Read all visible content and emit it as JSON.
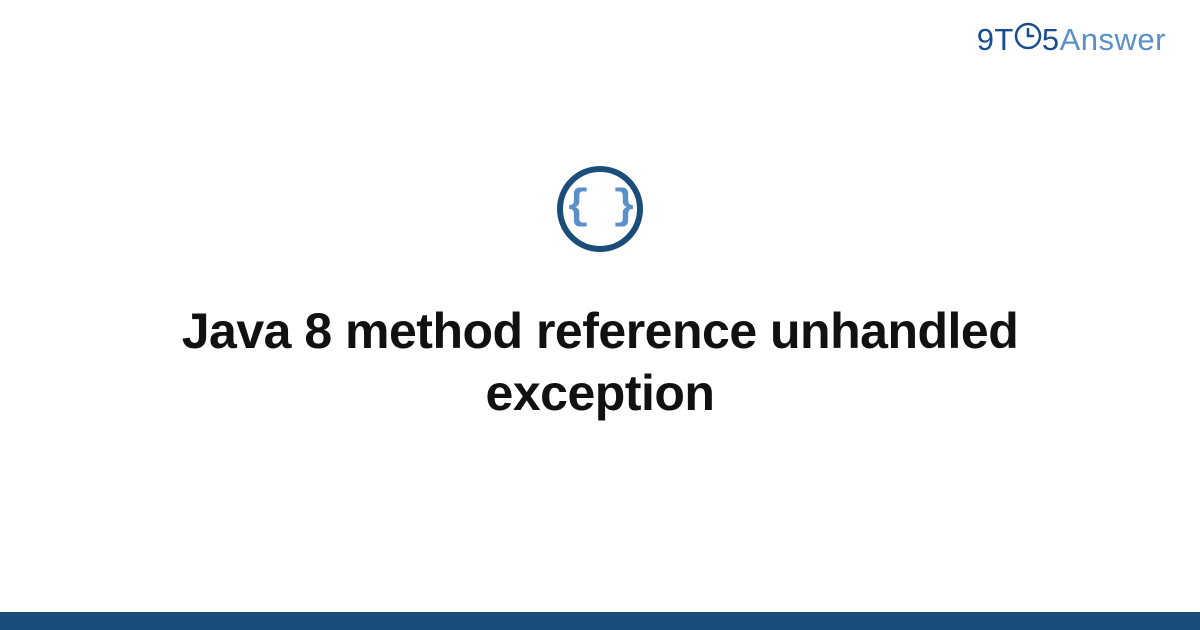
{
  "logo": {
    "part1": "9T",
    "part2": "5",
    "part3": "Answer"
  },
  "icon": {
    "braces": "{ }"
  },
  "title": "Java 8 method reference unhandled exception",
  "colors": {
    "primary_dark": "#1a4d7a",
    "primary_light": "#5a8fc7",
    "logo_dark": "#1a4d8f",
    "text": "#111111"
  }
}
